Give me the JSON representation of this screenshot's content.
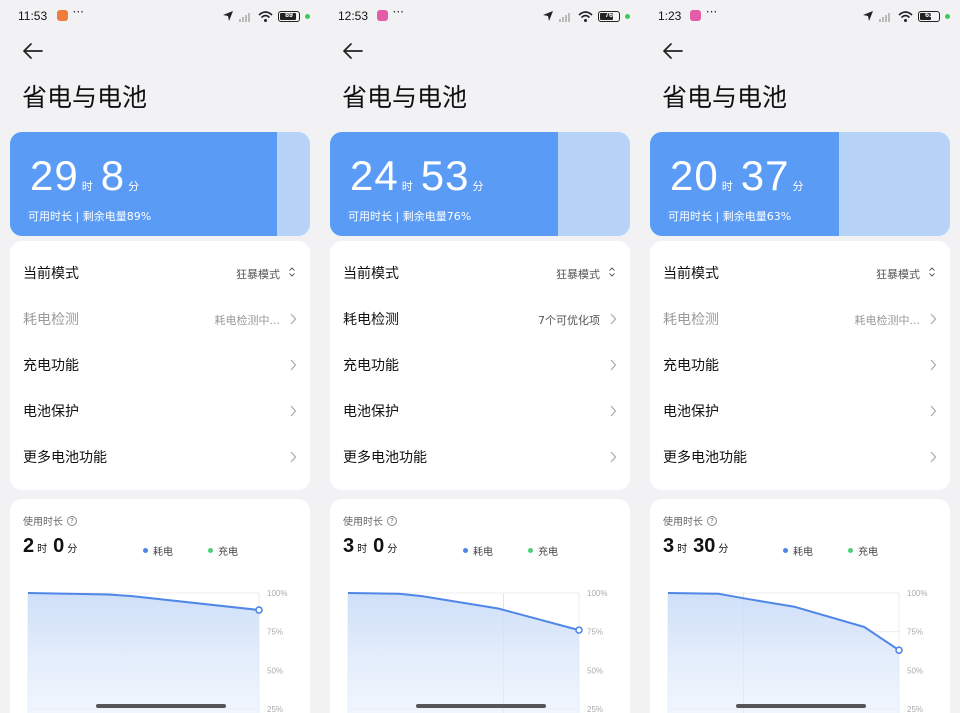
{
  "colors": {
    "accent": "#5a9bf5",
    "accent_light": "#b7d4f8",
    "drain": "#4f86e8",
    "charge": "#4fcf73"
  },
  "screens": [
    {
      "status": {
        "time": "11:53",
        "app_color": "#f07c3c",
        "battery": "89"
      },
      "title": "省电与电池",
      "hero": {
        "hours": "29",
        "hours_unit": "时",
        "minutes": "8",
        "minutes_unit": "分",
        "subtitle": "可用时长 | 剩余电量89%",
        "level": 0.89
      },
      "menu": [
        {
          "label": "当前模式",
          "value": "狂暴模式",
          "dim": false,
          "control": "updown"
        },
        {
          "label": "耗电检测",
          "value": "耗电检测中...",
          "dim": true,
          "control": "chevron"
        },
        {
          "label": "充电功能",
          "value": "",
          "dim": false,
          "control": "chevron"
        },
        {
          "label": "电池保护",
          "value": "",
          "dim": false,
          "control": "chevron"
        },
        {
          "label": "更多电池功能",
          "value": "",
          "dim": false,
          "control": "chevron"
        }
      ],
      "usage": {
        "label": "使用时长",
        "hours": "2",
        "hours_unit": "时",
        "minutes": "0",
        "minutes_unit": "分",
        "legend_drain": "耗电",
        "legend_charge": "充电"
      },
      "chart_data": {
        "type": "area",
        "y_ticks": [
          "100%",
          "75%",
          "50%",
          "25%"
        ],
        "ylim": [
          25,
          100
        ],
        "x": [
          0,
          0.35,
          0.45,
          1
        ],
        "values": [
          100,
          99,
          98,
          89
        ]
      }
    },
    {
      "status": {
        "time": "12:53",
        "app_color": "#e35ca8",
        "battery": "76"
      },
      "title": "省电与电池",
      "hero": {
        "hours": "24",
        "hours_unit": "时",
        "minutes": "53",
        "minutes_unit": "分",
        "subtitle": "可用时长 | 剩余电量76%",
        "level": 0.76
      },
      "menu": [
        {
          "label": "当前模式",
          "value": "狂暴模式",
          "dim": false,
          "control": "updown"
        },
        {
          "label": "耗电检测",
          "value": "7个可优化项",
          "dim": false,
          "control": "chevron"
        },
        {
          "label": "充电功能",
          "value": "",
          "dim": false,
          "control": "chevron"
        },
        {
          "label": "电池保护",
          "value": "",
          "dim": false,
          "control": "chevron"
        },
        {
          "label": "更多电池功能",
          "value": "",
          "dim": false,
          "control": "chevron"
        }
      ],
      "usage": {
        "label": "使用时长",
        "hours": "3",
        "hours_unit": "时",
        "minutes": "0",
        "minutes_unit": "分",
        "legend_drain": "耗电",
        "legend_charge": "充电"
      },
      "chart_data": {
        "type": "area",
        "y_ticks": [
          "100%",
          "75%",
          "50%",
          "25%"
        ],
        "ylim": [
          25,
          100
        ],
        "x": [
          0,
          0.22,
          0.32,
          0.65,
          1
        ],
        "values": [
          100,
          99.5,
          98,
          90,
          76
        ]
      }
    },
    {
      "status": {
        "time": "1:23",
        "app_color": "#e35ca8",
        "battery": "63"
      },
      "title": "省电与电池",
      "hero": {
        "hours": "20",
        "hours_unit": "时",
        "minutes": "37",
        "minutes_unit": "分",
        "subtitle": "可用时长 | 剩余电量63%",
        "level": 0.63
      },
      "menu": [
        {
          "label": "当前模式",
          "value": "狂暴模式",
          "dim": false,
          "control": "updown"
        },
        {
          "label": "耗电检测",
          "value": "耗电检测中...",
          "dim": true,
          "control": "chevron"
        },
        {
          "label": "充电功能",
          "value": "",
          "dim": false,
          "control": "chevron"
        },
        {
          "label": "电池保护",
          "value": "",
          "dim": false,
          "control": "chevron"
        },
        {
          "label": "更多电池功能",
          "value": "",
          "dim": false,
          "control": "chevron"
        }
      ],
      "usage": {
        "label": "使用时长",
        "hours": "3",
        "hours_unit": "时",
        "minutes": "30",
        "minutes_unit": "分",
        "legend_drain": "耗电",
        "legend_charge": "充电"
      },
      "chart_data": {
        "type": "area",
        "y_ticks": [
          "100%",
          "75%",
          "50%",
          "25%"
        ],
        "ylim": [
          25,
          100
        ],
        "x": [
          0,
          0.22,
          0.35,
          0.55,
          0.85,
          1
        ],
        "values": [
          100,
          99.5,
          96,
          91,
          78,
          63
        ]
      }
    }
  ]
}
